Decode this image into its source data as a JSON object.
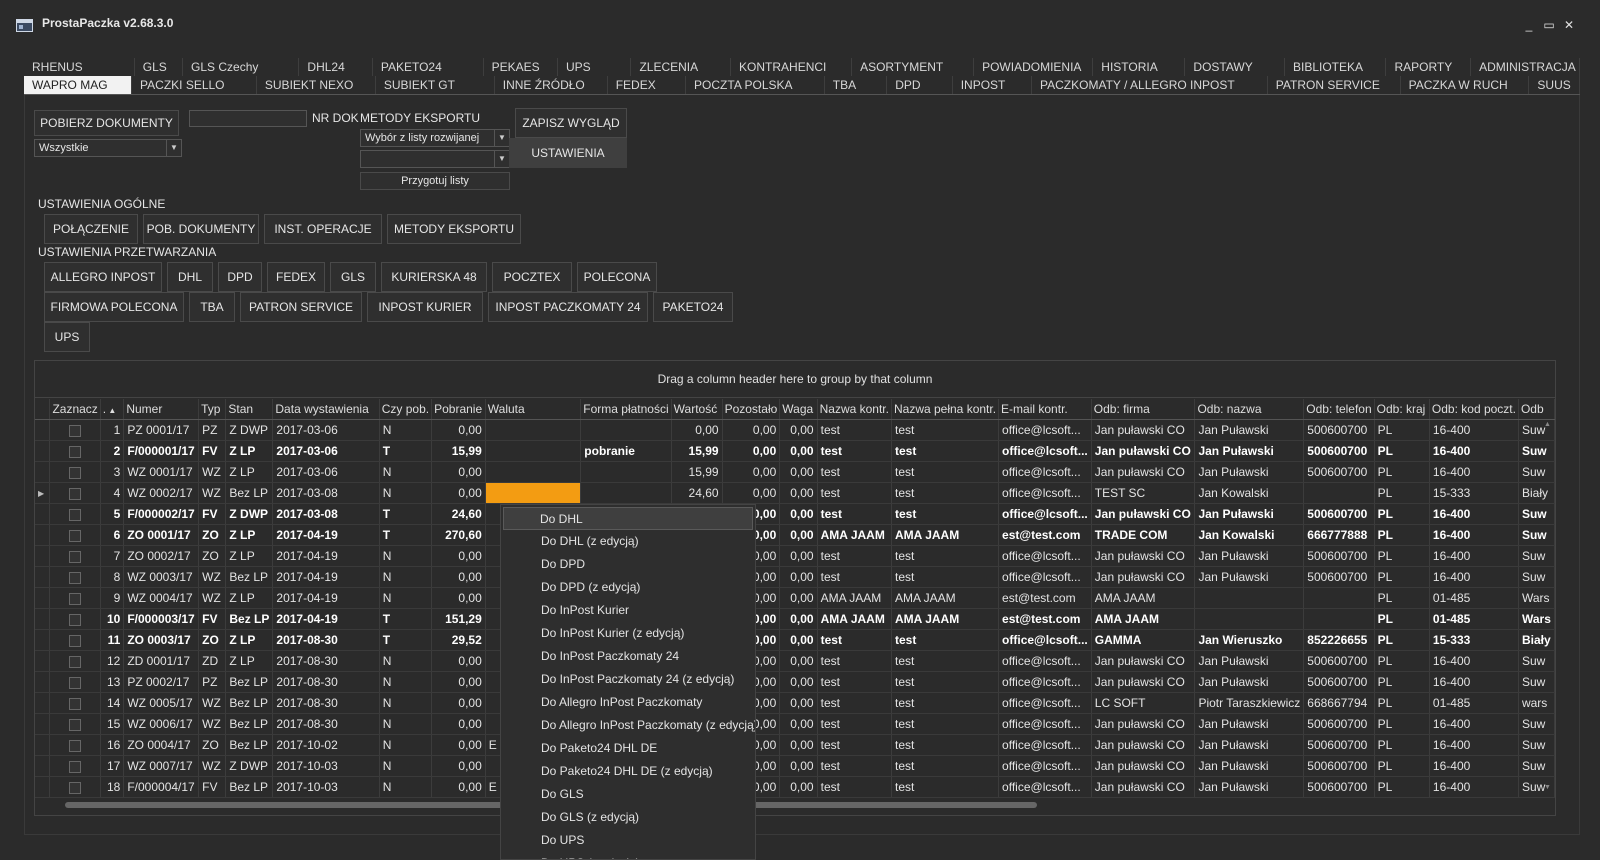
{
  "window": {
    "title": "ProstaPaczka v2.68.3.0",
    "controls": [
      "_",
      "▭",
      "✕"
    ]
  },
  "tabs_row1": [
    "RHENUS",
    "GLS",
    "GLS Czechy",
    "DHL24",
    "PAKETO24",
    "PEKAES",
    "UPS",
    "ZLECENIA",
    "KONTRAHENCI",
    "ASORTYMENT",
    "POWIADOMIENIA",
    "HISTORIA",
    "DOSTAWY",
    "BIBLIOTEKA",
    "RAPORTY",
    "ADMINISTRACJA"
  ],
  "tabs_row2": [
    "WAPRO MAG",
    "PACZKI SELLO",
    "SUBIEKT NEXO",
    "SUBIEKT GT",
    "INNE ŹRÓDŁO",
    "FEDEX",
    "POCZTA POLSKA",
    "TBA",
    "DPD",
    "INPOST",
    "PACZKOMATY / ALLEGRO INPOST",
    "PATRON SERVICE",
    "PACZKA W RUCH",
    "SUUS"
  ],
  "toolbar": {
    "fetch_docs": "POBIERZ DOKUMENTY",
    "filter_value": "Wszystkie",
    "nr_dok_label": "NR DOK",
    "nr_dok_value": "",
    "export_methods_label": "METODY EKSPORTU",
    "export_select": "Wybór z listy rozwijanej",
    "export_select2": "",
    "prepare_lists": "Przygotuj listy",
    "save_view": "ZAPISZ WYGLĄD",
    "settings": "USTAWIENIA"
  },
  "general_settings": {
    "heading": "USTAWIENIA OGÓLNE",
    "buttons": [
      "POŁĄCZENIE",
      "POB. DOKUMENTY",
      "INST. OPERACJE",
      "METODY EKSPORTU"
    ]
  },
  "processing_settings": {
    "heading": "USTAWIENIA PRZETWARZANIA",
    "row1": [
      "ALLEGRO INPOST",
      "DHL",
      "DPD",
      "FEDEX",
      "GLS",
      "KURIERSKA 48",
      "POCZTEX",
      "POLECONA"
    ],
    "row2": [
      "FIRMOWA POLECONA",
      "TBA",
      "PATRON SERVICE",
      "INPOST KURIER",
      "INPOST PACZKOMATY 24",
      "PAKETO24"
    ],
    "row3": [
      "UPS"
    ]
  },
  "grid": {
    "group_hint": "Drag a column header here to group by that column",
    "sort_arrow": "▲",
    "columns": [
      "Zaznacz",
      ".",
      "Numer",
      "Typ",
      "Stan",
      "Data wystawienia",
      "Czy pob.",
      "Pobranie",
      "Waluta",
      "Forma płatności",
      "Wartość",
      "Pozostało",
      "Waga",
      "Nazwa kontr.",
      "Nazwa pełna kontr.",
      "E-mail kontr.",
      "Odb: firma",
      "Odb: nazwa",
      "Odb: telefon",
      "Odb: kraj",
      "Odb: kod poczt.",
      "Odb"
    ],
    "rows": [
      {
        "n": "1",
        "num": "PZ 0001/17",
        "typ": "PZ",
        "stan": "Z DWP",
        "data": "2017-03-06",
        "pob": "N",
        "pobranie": "0,00",
        "waluta": "",
        "forma": "",
        "wartosc": "0,00",
        "pozostalo": "0,00",
        "waga": "0,00",
        "kontr": "test",
        "pelna": "test",
        "email": "office@lcsoft...",
        "firma": "Jan puławski CO",
        "nazwa": "Jan Puławski",
        "tel": "500600700",
        "kraj": "PL",
        "kod": "16-400",
        "odb": "Suw",
        "bold": false
      },
      {
        "n": "2",
        "num": "F/000001/17",
        "typ": "FV",
        "stan": "Z LP",
        "data": "2017-03-06",
        "pob": "T",
        "pobranie": "15,99",
        "waluta": "",
        "forma": "pobranie",
        "wartosc": "15,99",
        "pozostalo": "0,00",
        "waga": "0,00",
        "kontr": "test",
        "pelna": "test",
        "email": "office@lcsoft...",
        "firma": "Jan puławski CO",
        "nazwa": "Jan Puławski",
        "tel": "500600700",
        "kraj": "PL",
        "kod": "16-400",
        "odb": "Suw",
        "bold": true
      },
      {
        "n": "3",
        "num": "WZ 0001/17",
        "typ": "WZ",
        "stan": "Z LP",
        "data": "2017-03-06",
        "pob": "N",
        "pobranie": "0,00",
        "waluta": "",
        "forma": "",
        "wartosc": "15,99",
        "pozostalo": "0,00",
        "waga": "0,00",
        "kontr": "test",
        "pelna": "test",
        "email": "office@lcsoft...",
        "firma": "Jan puławski CO",
        "nazwa": "Jan Puławski",
        "tel": "500600700",
        "kraj": "PL",
        "kod": "16-400",
        "odb": "Suw",
        "bold": false
      },
      {
        "n": "4",
        "num": "WZ 0002/17",
        "typ": "WZ",
        "stan": "Bez LP",
        "data": "2017-03-08",
        "pob": "N",
        "pobranie": "0,00",
        "waluta": "",
        "forma": "",
        "wartosc": "24,60",
        "pozostalo": "0,00",
        "waga": "0,00",
        "kontr": "test",
        "pelna": "test",
        "email": "office@lcsoft...",
        "firma": "TEST SC",
        "nazwa": "Jan Kowalski",
        "tel": "",
        "kraj": "PL",
        "kod": "15-333",
        "odb": "Biały",
        "bold": false,
        "current": true
      },
      {
        "n": "5",
        "num": "F/000002/17",
        "typ": "FV",
        "stan": "Z DWP",
        "data": "2017-03-08",
        "pob": "T",
        "pobranie": "24,60",
        "waluta": "",
        "forma": "",
        "wartosc": "24,60",
        "pozostalo": "0,00",
        "waga": "0,00",
        "kontr": "test",
        "pelna": "test",
        "email": "office@lcsoft...",
        "firma": "Jan puławski CO",
        "nazwa": "Jan Puławski",
        "tel": "500600700",
        "kraj": "PL",
        "kod": "16-400",
        "odb": "Suw",
        "bold": true
      },
      {
        "n": "6",
        "num": "ZO 0001/17",
        "typ": "ZO",
        "stan": "Z LP",
        "data": "2017-04-19",
        "pob": "T",
        "pobranie": "270,60",
        "waluta": "",
        "forma": "",
        "wartosc": "",
        "pozostalo": "0,00",
        "waga": "0,00",
        "kontr": "AMA JAAM",
        "pelna": "AMA JAAM",
        "email": "est@test.com",
        "firma": "TRADE COM",
        "nazwa": "Jan Kowalski",
        "tel": "666777888",
        "kraj": "PL",
        "kod": "16-400",
        "odb": "Suw",
        "bold": true
      },
      {
        "n": "7",
        "num": "ZO 0002/17",
        "typ": "ZO",
        "stan": "Z LP",
        "data": "2017-04-19",
        "pob": "N",
        "pobranie": "0,00",
        "waluta": "",
        "forma": "",
        "wartosc": "",
        "pozostalo": "0,00",
        "waga": "0,00",
        "kontr": "test",
        "pelna": "test",
        "email": "office@lcsoft...",
        "firma": "Jan puławski CO",
        "nazwa": "Jan Puławski",
        "tel": "500600700",
        "kraj": "PL",
        "kod": "16-400",
        "odb": "Suw",
        "bold": false
      },
      {
        "n": "8",
        "num": "WZ 0003/17",
        "typ": "WZ",
        "stan": "Bez LP",
        "data": "2017-04-19",
        "pob": "N",
        "pobranie": "0,00",
        "waluta": "",
        "forma": "",
        "wartosc": "",
        "pozostalo": "0,00",
        "waga": "0,00",
        "kontr": "test",
        "pelna": "test",
        "email": "office@lcsoft...",
        "firma": "Jan puławski CO",
        "nazwa": "Jan Puławski",
        "tel": "500600700",
        "kraj": "PL",
        "kod": "16-400",
        "odb": "Suw",
        "bold": false
      },
      {
        "n": "9",
        "num": "WZ 0004/17",
        "typ": "WZ",
        "stan": "Z LP",
        "data": "2017-04-19",
        "pob": "N",
        "pobranie": "0,00",
        "waluta": "",
        "forma": "",
        "wartosc": "",
        "pozostalo": "0,00",
        "waga": "0,00",
        "kontr": "AMA JAAM",
        "pelna": "AMA JAAM",
        "email": "est@test.com",
        "firma": "AMA JAAM",
        "nazwa": "",
        "tel": "",
        "kraj": "PL",
        "kod": "01-485",
        "odb": "Wars",
        "bold": false
      },
      {
        "n": "10",
        "num": "F/000003/17",
        "typ": "FV",
        "stan": "Bez LP",
        "data": "2017-04-19",
        "pob": "T",
        "pobranie": "151,29",
        "waluta": "",
        "forma": "",
        "wartosc": "151,29",
        "pozostalo": "0,00",
        "waga": "0,00",
        "kontr": "AMA JAAM",
        "pelna": "AMA JAAM",
        "email": "est@test.com",
        "firma": "AMA JAAM",
        "nazwa": "",
        "tel": "",
        "kraj": "PL",
        "kod": "01-485",
        "odb": "Wars",
        "bold": true
      },
      {
        "n": "11",
        "num": "ZO 0003/17",
        "typ": "ZO",
        "stan": "Z LP",
        "data": "2017-08-30",
        "pob": "T",
        "pobranie": "29,52",
        "waluta": "",
        "forma": "",
        "wartosc": "",
        "pozostalo": "0,00",
        "waga": "0,00",
        "kontr": "test",
        "pelna": "test",
        "email": "office@lcsoft...",
        "firma": "GAMMA",
        "nazwa": "Jan Wieruszko",
        "tel": "852226655",
        "kraj": "PL",
        "kod": "15-333",
        "odb": "Biały",
        "bold": true
      },
      {
        "n": "12",
        "num": "ZD 0001/17",
        "typ": "ZD",
        "stan": "Z LP",
        "data": "2017-08-30",
        "pob": "N",
        "pobranie": "0,00",
        "waluta": "",
        "forma": "",
        "wartosc": "",
        "pozostalo": "0,00",
        "waga": "0,00",
        "kontr": "test",
        "pelna": "test",
        "email": "office@lcsoft...",
        "firma": "Jan puławski CO",
        "nazwa": "Jan Puławski",
        "tel": "500600700",
        "kraj": "PL",
        "kod": "16-400",
        "odb": "Suw",
        "bold": false
      },
      {
        "n": "13",
        "num": "PZ 0002/17",
        "typ": "PZ",
        "stan": "Bez LP",
        "data": "2017-08-30",
        "pob": "N",
        "pobranie": "0,00",
        "waluta": "",
        "forma": "",
        "wartosc": "",
        "pozostalo": "0,00",
        "waga": "0,00",
        "kontr": "test",
        "pelna": "test",
        "email": "office@lcsoft...",
        "firma": "Jan puławski CO",
        "nazwa": "Jan Puławski",
        "tel": "500600700",
        "kraj": "PL",
        "kod": "16-400",
        "odb": "Suw",
        "bold": false
      },
      {
        "n": "14",
        "num": "WZ 0005/17",
        "typ": "WZ",
        "stan": "Bez LP",
        "data": "2017-08-30",
        "pob": "N",
        "pobranie": "0,00",
        "waluta": "",
        "forma": "",
        "wartosc": "",
        "pozostalo": "0,00",
        "waga": "0,00",
        "kontr": "test",
        "pelna": "test",
        "email": "office@lcsoft...",
        "firma": "LC SOFT",
        "nazwa": "Piotr Taraszkiewicz",
        "tel": "668667794",
        "kraj": "PL",
        "kod": "01-485",
        "odb": "wars",
        "bold": false
      },
      {
        "n": "15",
        "num": "WZ 0006/17",
        "typ": "WZ",
        "stan": "Bez LP",
        "data": "2017-08-30",
        "pob": "N",
        "pobranie": "0,00",
        "waluta": "",
        "forma": "",
        "wartosc": "",
        "pozostalo": "0,00",
        "waga": "0,00",
        "kontr": "test",
        "pelna": "test",
        "email": "office@lcsoft...",
        "firma": "Jan puławski CO",
        "nazwa": "Jan Puławski",
        "tel": "500600700",
        "kraj": "PL",
        "kod": "16-400",
        "odb": "Suw",
        "bold": false
      },
      {
        "n": "16",
        "num": "ZO 0004/17",
        "typ": "ZO",
        "stan": "Bez LP",
        "data": "2017-10-02",
        "pob": "N",
        "pobranie": "0,00",
        "waluta": "E",
        "forma": "",
        "wartosc": "",
        "pozostalo": "0,00",
        "waga": "0,00",
        "kontr": "test",
        "pelna": "test",
        "email": "office@lcsoft...",
        "firma": "Jan puławski CO",
        "nazwa": "Jan Puławski",
        "tel": "500600700",
        "kraj": "PL",
        "kod": "16-400",
        "odb": "Suw",
        "bold": false
      },
      {
        "n": "17",
        "num": "WZ 0007/17",
        "typ": "WZ",
        "stan": "Z DWP",
        "data": "2017-10-03",
        "pob": "N",
        "pobranie": "0,00",
        "waluta": "",
        "forma": "",
        "wartosc": "",
        "pozostalo": "0,00",
        "waga": "0,00",
        "kontr": "test",
        "pelna": "test",
        "email": "office@lcsoft...",
        "firma": "Jan puławski CO",
        "nazwa": "Jan Puławski",
        "tel": "500600700",
        "kraj": "PL",
        "kod": "16-400",
        "odb": "Suw",
        "bold": false
      },
      {
        "n": "18",
        "num": "F/000004/17",
        "typ": "FV",
        "stan": "Bez LP",
        "data": "2017-10-03",
        "pob": "N",
        "pobranie": "0,00",
        "waluta": "E",
        "forma": "",
        "wartosc": "",
        "pozostalo": "0,00",
        "waga": "0,00",
        "kontr": "test",
        "pelna": "test",
        "email": "office@lcsoft...",
        "firma": "Jan puławski CO",
        "nazwa": "Jan Puławski",
        "tel": "500600700",
        "kraj": "PL",
        "kod": "16-400",
        "odb": "Suw",
        "bold": false
      }
    ]
  },
  "context_menu": {
    "items": [
      "Do DHL",
      "Do DHL (z edycją)",
      "Do DPD",
      "Do DPD (z edycją)",
      "Do InPost Kurier",
      "Do InPost Kurier (z edycją)",
      "Do InPost Paczkomaty 24",
      "Do InPost Paczkomaty 24 (z edycją)",
      "Do Allegro InPost Paczkomaty",
      "Do Allegro InPost Paczkomaty (z edycją)",
      "Do Paketo24 DHL DE",
      "Do Paketo24 DHL DE (z edycją)",
      "Do GLS",
      "Do GLS (z edycją)",
      "Do UPS",
      "Do UPS (z edycją)"
    ],
    "highlighted": 0
  },
  "colors": {
    "background": "#2b2b2b",
    "highlight_cell": "#f39c12",
    "active_tab": "#f2f2f2"
  }
}
